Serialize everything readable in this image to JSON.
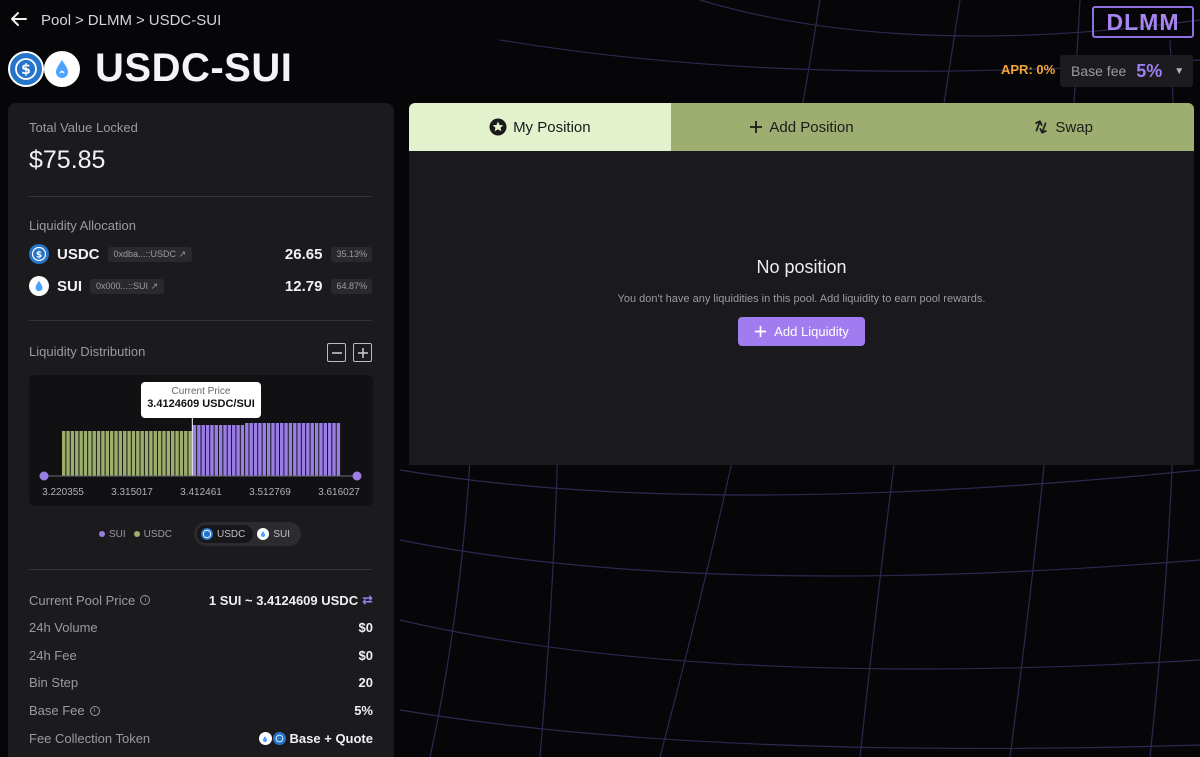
{
  "header": {
    "breadcrumb": [
      "Pool",
      ">",
      "DLMM",
      ">",
      "USDC-SUI"
    ],
    "pair_title": "USDC-SUI",
    "badge": "DLMM",
    "apr": "APR: 0%",
    "base_fee_label": "Base fee",
    "base_fee_value": "5%"
  },
  "overview": {
    "tvl_label": "Total Value Locked",
    "tvl_value": "$75.85",
    "allocation_label": "Liquidity Allocation",
    "allocation": [
      {
        "symbol": "USDC",
        "address": "0xdba...::USDC",
        "amount": "26.65",
        "percent": "35.13%"
      },
      {
        "symbol": "SUI",
        "address": "0x000...::SUI",
        "amount": "12.79",
        "percent": "64.87%"
      }
    ],
    "distribution_label": "Liquidity Distribution"
  },
  "distribution_chart": {
    "tooltip_title": "Current Price",
    "tooltip_value": "3.4124609 USDC/SUI",
    "x_ticks": [
      "3.220355",
      "3.315017",
      "3.412461",
      "3.512769",
      "3.616027"
    ],
    "usdc_bar_count": 30,
    "sui_bar_count": 34,
    "legend": {
      "sui": "SUI",
      "usdc": "USDC"
    },
    "toggle": {
      "usdc": "USDC",
      "sui": "SUI"
    },
    "colors": {
      "usdc": "#9dae6d",
      "sui": "#9b7de6",
      "handle": "#9b7de6"
    }
  },
  "stats": [
    {
      "key": "Current Pool Price",
      "value": "1 SUI ~ 3.4124609 USDC",
      "info": true,
      "swap_icon": true
    },
    {
      "key": "24h Volume",
      "value": "$0"
    },
    {
      "key": "24h Fee",
      "value": "$0"
    },
    {
      "key": "Bin Step",
      "value": "20"
    },
    {
      "key": "Base Fee",
      "value": "5%",
      "info": true
    },
    {
      "key": "Fee Collection Token",
      "value": "Base + Quote"
    }
  ],
  "tabs": [
    {
      "label": "My Position",
      "icon": "star-icon",
      "active": true
    },
    {
      "label": "Add Position",
      "icon": "plus-icon"
    },
    {
      "label": "Swap",
      "icon": "swap-icon"
    }
  ],
  "position": {
    "title": "No position",
    "subtitle": "You don't have any liquidities in this pool. Add liquidity to earn pool rewards.",
    "button": "Add Liquidity"
  },
  "colors": {
    "accent": "#a07cf0",
    "tab_active": "#e4f1cd",
    "tab_inactive": "#9ead70",
    "apr": "#f0a63a"
  }
}
